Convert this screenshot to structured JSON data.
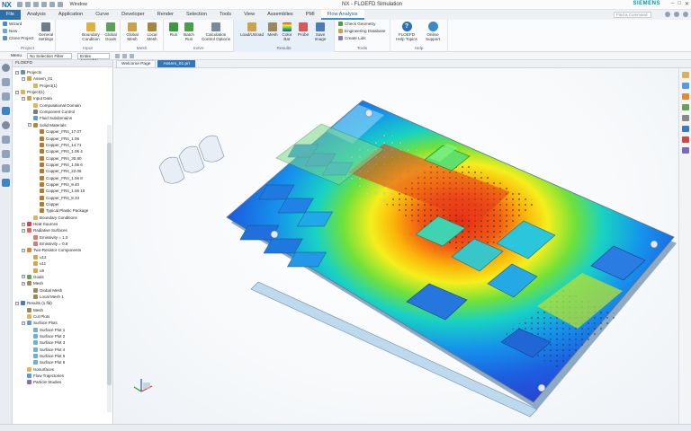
{
  "title_bar": {
    "logo": "NX",
    "window_menu": "Window",
    "app_title": "NX - FLOEFD Simulation",
    "brand": "SIEMENS"
  },
  "menu": {
    "tabs": [
      "File",
      "Analysis",
      "Application",
      "Curve",
      "Developer",
      "Render",
      "Selection",
      "Tools",
      "View",
      "Assemblies",
      "PMI",
      "Flow Analysis"
    ],
    "active_tab": "Flow Analysis",
    "search_placeholder": "Find a Command"
  },
  "ribbon": {
    "project_group": {
      "name": "Project",
      "items": [
        "Wizard",
        "New",
        "Clone Project"
      ],
      "general_settings": "General Settings"
    },
    "input_group": {
      "name": "Input",
      "items": [
        "Boundary Condition",
        "Global Goals"
      ]
    },
    "mesh_group": {
      "name": "Mesh",
      "items": [
        "Global Mesh",
        "Local Mesh"
      ]
    },
    "solve_group": {
      "name": "Solve",
      "items": [
        "Run",
        "Batch Run",
        "Calculation Control Options"
      ]
    },
    "results_group": {
      "name": "Results",
      "items": [
        "Load/Unload",
        "Mesh",
        "Color Bar",
        "Probe",
        "Save Image"
      ]
    },
    "tools_group": {
      "name": "Tools",
      "items": [
        "Check Geometry",
        "Engineering Database",
        "Create Lids"
      ]
    },
    "help_group": {
      "name": "Help",
      "items": [
        "FLOEFD Help Topics",
        "Online Support"
      ]
    }
  },
  "selection_bar": {
    "menu_label": "Menu",
    "filter": "No Selection Filter",
    "scope": "Entire Assembly"
  },
  "navigator": {
    "header": "FLOEFD",
    "rows": [
      {
        "level": 0,
        "label": "Projects",
        "icon": "#6d8db0",
        "exp": "−"
      },
      {
        "level": 1,
        "label": "Assem_01",
        "icon": "#c9a24a",
        "exp": "−"
      },
      {
        "level": 2,
        "label": "Project(1)",
        "icon": "#d8b45a",
        "exp": ""
      },
      {
        "level": 0,
        "label": "Project(1)",
        "icon": "#d8b45a",
        "exp": "−"
      },
      {
        "level": 1,
        "label": "Input Data",
        "icon": "#c9a24a",
        "exp": "−"
      },
      {
        "level": 2,
        "label": "Computational Domain",
        "icon": "#d9b85a",
        "exp": ""
      },
      {
        "level": 2,
        "label": "Component Control",
        "icon": "#7a7a7a",
        "exp": ""
      },
      {
        "level": 2,
        "label": "Fluid Subdomains",
        "icon": "#5a9be0",
        "exp": ""
      },
      {
        "level": 2,
        "label": "Solid Materials",
        "icon": "#b08a3a",
        "exp": "−"
      },
      {
        "level": 3,
        "label": "Copper_FR4_17.07",
        "icon": "#b57a2a",
        "exp": ""
      },
      {
        "level": 3,
        "label": "Copper_FR4_1.06",
        "icon": "#b57a2a",
        "exp": ""
      },
      {
        "level": 3,
        "label": "Copper_FR4_14.71",
        "icon": "#b57a2a",
        "exp": ""
      },
      {
        "level": 3,
        "label": "Copper_FR4_1.06 4",
        "icon": "#b57a2a",
        "exp": ""
      },
      {
        "level": 3,
        "label": "Copper_FR4_30.80",
        "icon": "#b57a2a",
        "exp": ""
      },
      {
        "level": 3,
        "label": "Copper_FR4_1.06 6",
        "icon": "#b57a2a",
        "exp": ""
      },
      {
        "level": 3,
        "label": "Copper_FR4_22.06",
        "icon": "#b57a2a",
        "exp": ""
      },
      {
        "level": 3,
        "label": "Copper_FR4_1.06 8",
        "icon": "#b57a2a",
        "exp": ""
      },
      {
        "level": 3,
        "label": "Copper_FR4_9.40",
        "icon": "#b57a2a",
        "exp": ""
      },
      {
        "level": 3,
        "label": "Copper_FR4_1.06 10",
        "icon": "#b57a2a",
        "exp": ""
      },
      {
        "level": 3,
        "label": "Copper_FR4_8.33",
        "icon": "#b57a2a",
        "exp": ""
      },
      {
        "level": 3,
        "label": "Copper",
        "icon": "#b57a2a",
        "exp": ""
      },
      {
        "level": 3,
        "label": "Typical Plastic Package",
        "icon": "#b57a2a",
        "exp": ""
      },
      {
        "level": 2,
        "label": "Boundary Conditions",
        "icon": "#d9b85a",
        "exp": ""
      },
      {
        "level": 1,
        "label": "Heat Sources",
        "icon": "#d44",
        "exp": "+"
      },
      {
        "level": 1,
        "label": "Radiative Surfaces",
        "icon": "#d66",
        "exp": "−"
      },
      {
        "level": 2,
        "label": "Emissivity = 1.0",
        "icon": "#d77",
        "exp": ""
      },
      {
        "level": 2,
        "label": "Emissivity = 0.8",
        "icon": "#d77",
        "exp": ""
      },
      {
        "level": 1,
        "label": "Two-Resistor Components",
        "icon": "#c84",
        "exp": "−"
      },
      {
        "level": 2,
        "label": "u12",
        "icon": "#d9a450",
        "exp": ""
      },
      {
        "level": 2,
        "label": "u11",
        "icon": "#d9a450",
        "exp": ""
      },
      {
        "level": 2,
        "label": "u9",
        "icon": "#d9a450",
        "exp": ""
      },
      {
        "level": 1,
        "label": "Goals",
        "icon": "#6aa05a",
        "exp": "+"
      },
      {
        "level": 1,
        "label": "Mesh",
        "icon": "#9a8a5a",
        "exp": "−"
      },
      {
        "level": 2,
        "label": "Global Mesh",
        "icon": "#9a8a5a",
        "exp": ""
      },
      {
        "level": 2,
        "label": "Local Mesh 1",
        "icon": "#9a8a5a",
        "exp": ""
      },
      {
        "level": 0,
        "label": "Results (1.fld)",
        "icon": "#4a7ab8",
        "exp": "−"
      },
      {
        "level": 1,
        "label": "Mesh",
        "icon": "#9a8a5a",
        "exp": ""
      },
      {
        "level": 1,
        "label": "Cut Plots",
        "icon": "#d9b85a",
        "exp": ""
      },
      {
        "level": 1,
        "label": "Surface Plots",
        "icon": "#5aa0d8",
        "exp": "−"
      },
      {
        "level": 2,
        "label": "Surface Plot 1",
        "icon": "#6ab0e0",
        "exp": ""
      },
      {
        "level": 2,
        "label": "Surface Plot 2",
        "icon": "#6ab0e0",
        "exp": ""
      },
      {
        "level": 2,
        "label": "Surface Plot 3",
        "icon": "#6ab0e0",
        "exp": ""
      },
      {
        "level": 2,
        "label": "Surface Plot 4",
        "icon": "#6ab0e0",
        "exp": ""
      },
      {
        "level": 2,
        "label": "Surface Plot 5",
        "icon": "#6ab0e0",
        "exp": ""
      },
      {
        "level": 2,
        "label": "Surface Plot 6",
        "icon": "#6ab0e0",
        "exp": ""
      },
      {
        "level": 1,
        "label": "Isosurfaces",
        "icon": "#d9b85a",
        "exp": ""
      },
      {
        "level": 1,
        "label": "Flow Trajectories",
        "icon": "#5a9be0",
        "exp": ""
      },
      {
        "level": 1,
        "label": "Particle Studies",
        "icon": "#8a6ab8",
        "exp": ""
      }
    ]
  },
  "documents": {
    "tabs": [
      "Welcome Page",
      "Assem_01.prt"
    ],
    "active": "Assem_01.prt"
  },
  "colors": {
    "accent": "#2f78bf",
    "file_tab": "#2f6fa7",
    "brand": "#009999"
  }
}
